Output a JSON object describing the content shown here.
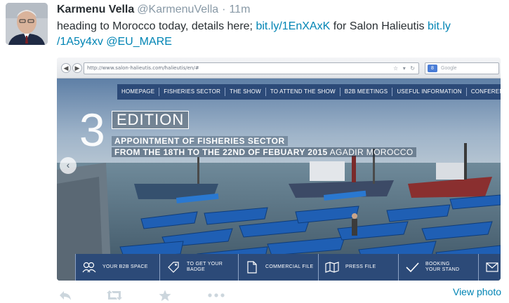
{
  "tweet": {
    "author_name": "Karmenu Vella",
    "author_handle": "@KarmenuVella",
    "separator": "·",
    "time": "11m",
    "text_parts": [
      {
        "text": "heading to Morocco today, details here; ",
        "kind": "text"
      },
      {
        "text": "bit.ly/1EnXAxK",
        "kind": "link"
      },
      {
        "text": " for Salon Halieutis ",
        "kind": "text"
      },
      {
        "text": "bit.ly",
        "kind": "link"
      },
      {
        "text": "/1A5y4xv",
        "kind": "link"
      },
      {
        "text": " ",
        "kind": "text"
      },
      {
        "text": "@EU_MARE",
        "kind": "link"
      }
    ],
    "view_photo": "View photo",
    "icons": [
      "reply-icon",
      "retweet-icon",
      "favorite-icon",
      "more-icon"
    ]
  },
  "media": {
    "browser": {
      "url": "http://www.salon-halieutis.com/halieutis/en/#",
      "search_placeholder": "Google",
      "search_engine_badge": "8"
    },
    "site": {
      "nav": [
        "HOMEPAGE",
        "FISHERIES SECTOR",
        "THE SHOW",
        "TO ATTEND THE SHOW",
        "B2B MEETINGS",
        "USEFUL INFORMATION",
        "CONFERENCES / L"
      ],
      "edition_number": "3",
      "edition_label": "EDITION",
      "headline1_prefix": "APPOINTMENT ",
      "headline1_main": "OF FISHERIES SECTOR",
      "headline2_main": "FROM THE 18TH TO THE 22ND OF FEBUARY 2015",
      "headline2_suffix": " AGADIR MOROCCO",
      "bottom": [
        {
          "label": "YOUR B2B SPACE",
          "icon": "users-icon"
        },
        {
          "label": "TO GET YOUR BADGE",
          "icon": "tag-icon"
        },
        {
          "label": "COMMERCIAL FILE",
          "icon": "document-icon"
        },
        {
          "label": "PRESS FILE",
          "icon": "map-icon"
        },
        {
          "label": "BOOKING YOUR STAND",
          "icon": "check-icon"
        },
        {
          "label": "",
          "icon": "mail-icon"
        }
      ]
    }
  },
  "colors": {
    "link": "#0084b4",
    "muted": "#8899a6",
    "site_nav": "#2c4a78"
  }
}
